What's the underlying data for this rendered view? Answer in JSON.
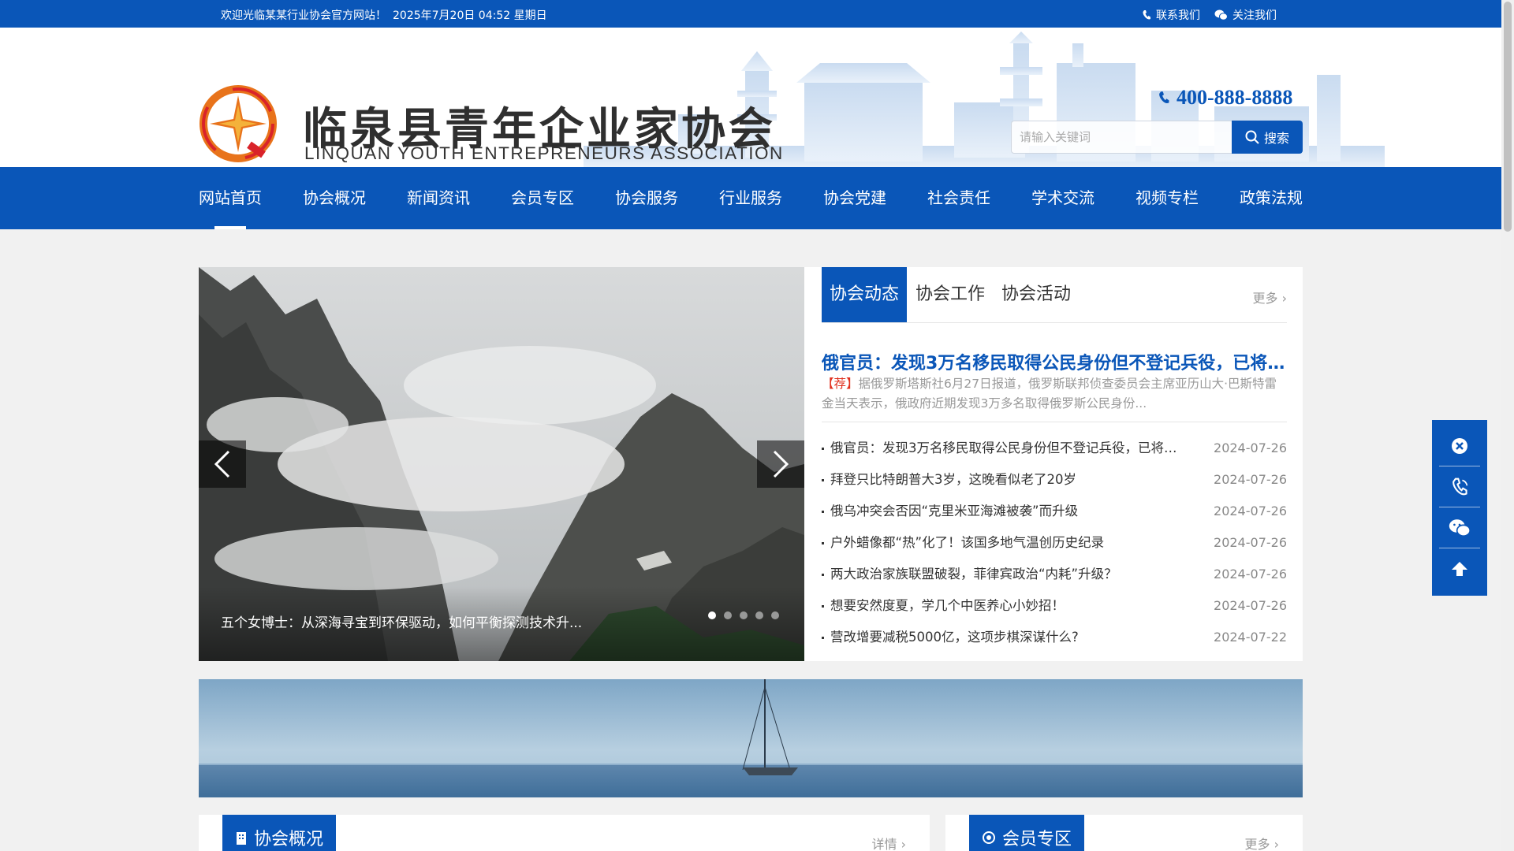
{
  "topbar": {
    "welcome": "欢迎光临某某行业协会官方网站！",
    "date": "2025年7月20日 04:52 星期日",
    "contact": "联系我们",
    "follow": "关注我们"
  },
  "header": {
    "logo_cn": "临泉县青年企业家协会",
    "logo_en": "LINQUAN YOUTH ENTREPRENEURS ASSOCIATION",
    "phone": "400-888-8888",
    "search_placeholder": "请输入关键词",
    "search_button": "搜索"
  },
  "nav": {
    "items": [
      {
        "label": "网站首页"
      },
      {
        "label": "协会概况"
      },
      {
        "label": "新闻资讯"
      },
      {
        "label": "会员专区"
      },
      {
        "label": "协会服务"
      },
      {
        "label": "行业服务"
      },
      {
        "label": "协会党建"
      },
      {
        "label": "社会责任"
      },
      {
        "label": "学术交流"
      },
      {
        "label": "视频专栏"
      },
      {
        "label": "政策法规"
      }
    ]
  },
  "slider": {
    "caption": "五个女博士：从深海寻宝到环保驱动，如何平衡探测技术升...",
    "dot_count": 5,
    "active_dot": 1
  },
  "news": {
    "tabs": [
      {
        "label": "协会动态"
      },
      {
        "label": "协会工作"
      },
      {
        "label": "协会活动"
      }
    ],
    "more": "更多",
    "headline": "俄官员：发现3万名移民取得公民身份但不登记兵役，已将...",
    "summary_tag": "【荐】",
    "summary": "据俄罗斯塔斯社6月27日报道，俄罗斯联邦侦查委员会主席亚历山大·巴斯特雷金当天表示，俄政府近期发现3万多名取得俄罗斯公民身份...",
    "items": [
      {
        "title": "俄官员：发现3万名移民取得公民身份但不登记兵役，已将1...",
        "date": "2024-07-26"
      },
      {
        "title": "拜登只比特朗普大3岁，这晚看似老了20岁",
        "date": "2024-07-26"
      },
      {
        "title": "俄乌冲突会否因“克里米亚海滩被袭”而升级",
        "date": "2024-07-26"
      },
      {
        "title": "户外蜡像都“热”化了！该国多地气温创历史纪录",
        "date": "2024-07-26"
      },
      {
        "title": "两大政治家族联盟破裂，菲律宾政治“内耗”升级？",
        "date": "2024-07-26"
      },
      {
        "title": "想要安然度夏，学几个中医养心小妙招！",
        "date": "2024-07-26"
      },
      {
        "title": "营改增要减税5000亿，这项步棋深谋什么?",
        "date": "2024-07-22"
      }
    ]
  },
  "sections": {
    "overview": {
      "title": "协会概况",
      "more": "详情"
    },
    "members": {
      "title": "会员专区",
      "more": "更多"
    }
  },
  "icons": {
    "phone": "phone-icon",
    "wechat": "wechat-icon",
    "search": "search-icon",
    "close": "close-icon",
    "arrow_up": "arrow-up-icon"
  },
  "colors": {
    "brand": "#0a56b8",
    "accent_red": "#e0301e"
  }
}
